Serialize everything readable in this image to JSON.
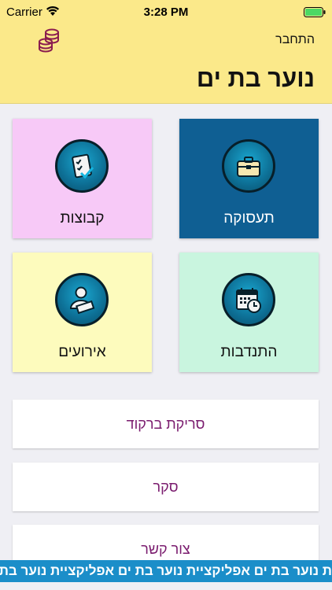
{
  "status_bar": {
    "carrier": "Carrier",
    "time": "3:28 PM"
  },
  "header": {
    "login_label": "התחבר",
    "title": "נוער בת ים"
  },
  "tiles": {
    "employment": "תעסוקה",
    "groups": "קבוצות",
    "volunteering": "התנדבות",
    "events": "אירועים"
  },
  "buttons": {
    "barcode": "סריקת ברקוד",
    "survey": "סקר",
    "contact": "צור קשר"
  },
  "ticker": {
    "text": "ת נוער בת ים אפליקציית נוער בת ים אפליקציית נוער בת ים"
  },
  "colors": {
    "header_bg": "#fbe98a",
    "employment_tile": "#0f5f93",
    "groups_tile": "#f7c9f7",
    "volunteer_tile": "#c9f5df",
    "events_tile": "#fdfbbd",
    "button_text": "#7a1b6e",
    "ticker_bg": "#1b8ec9"
  }
}
